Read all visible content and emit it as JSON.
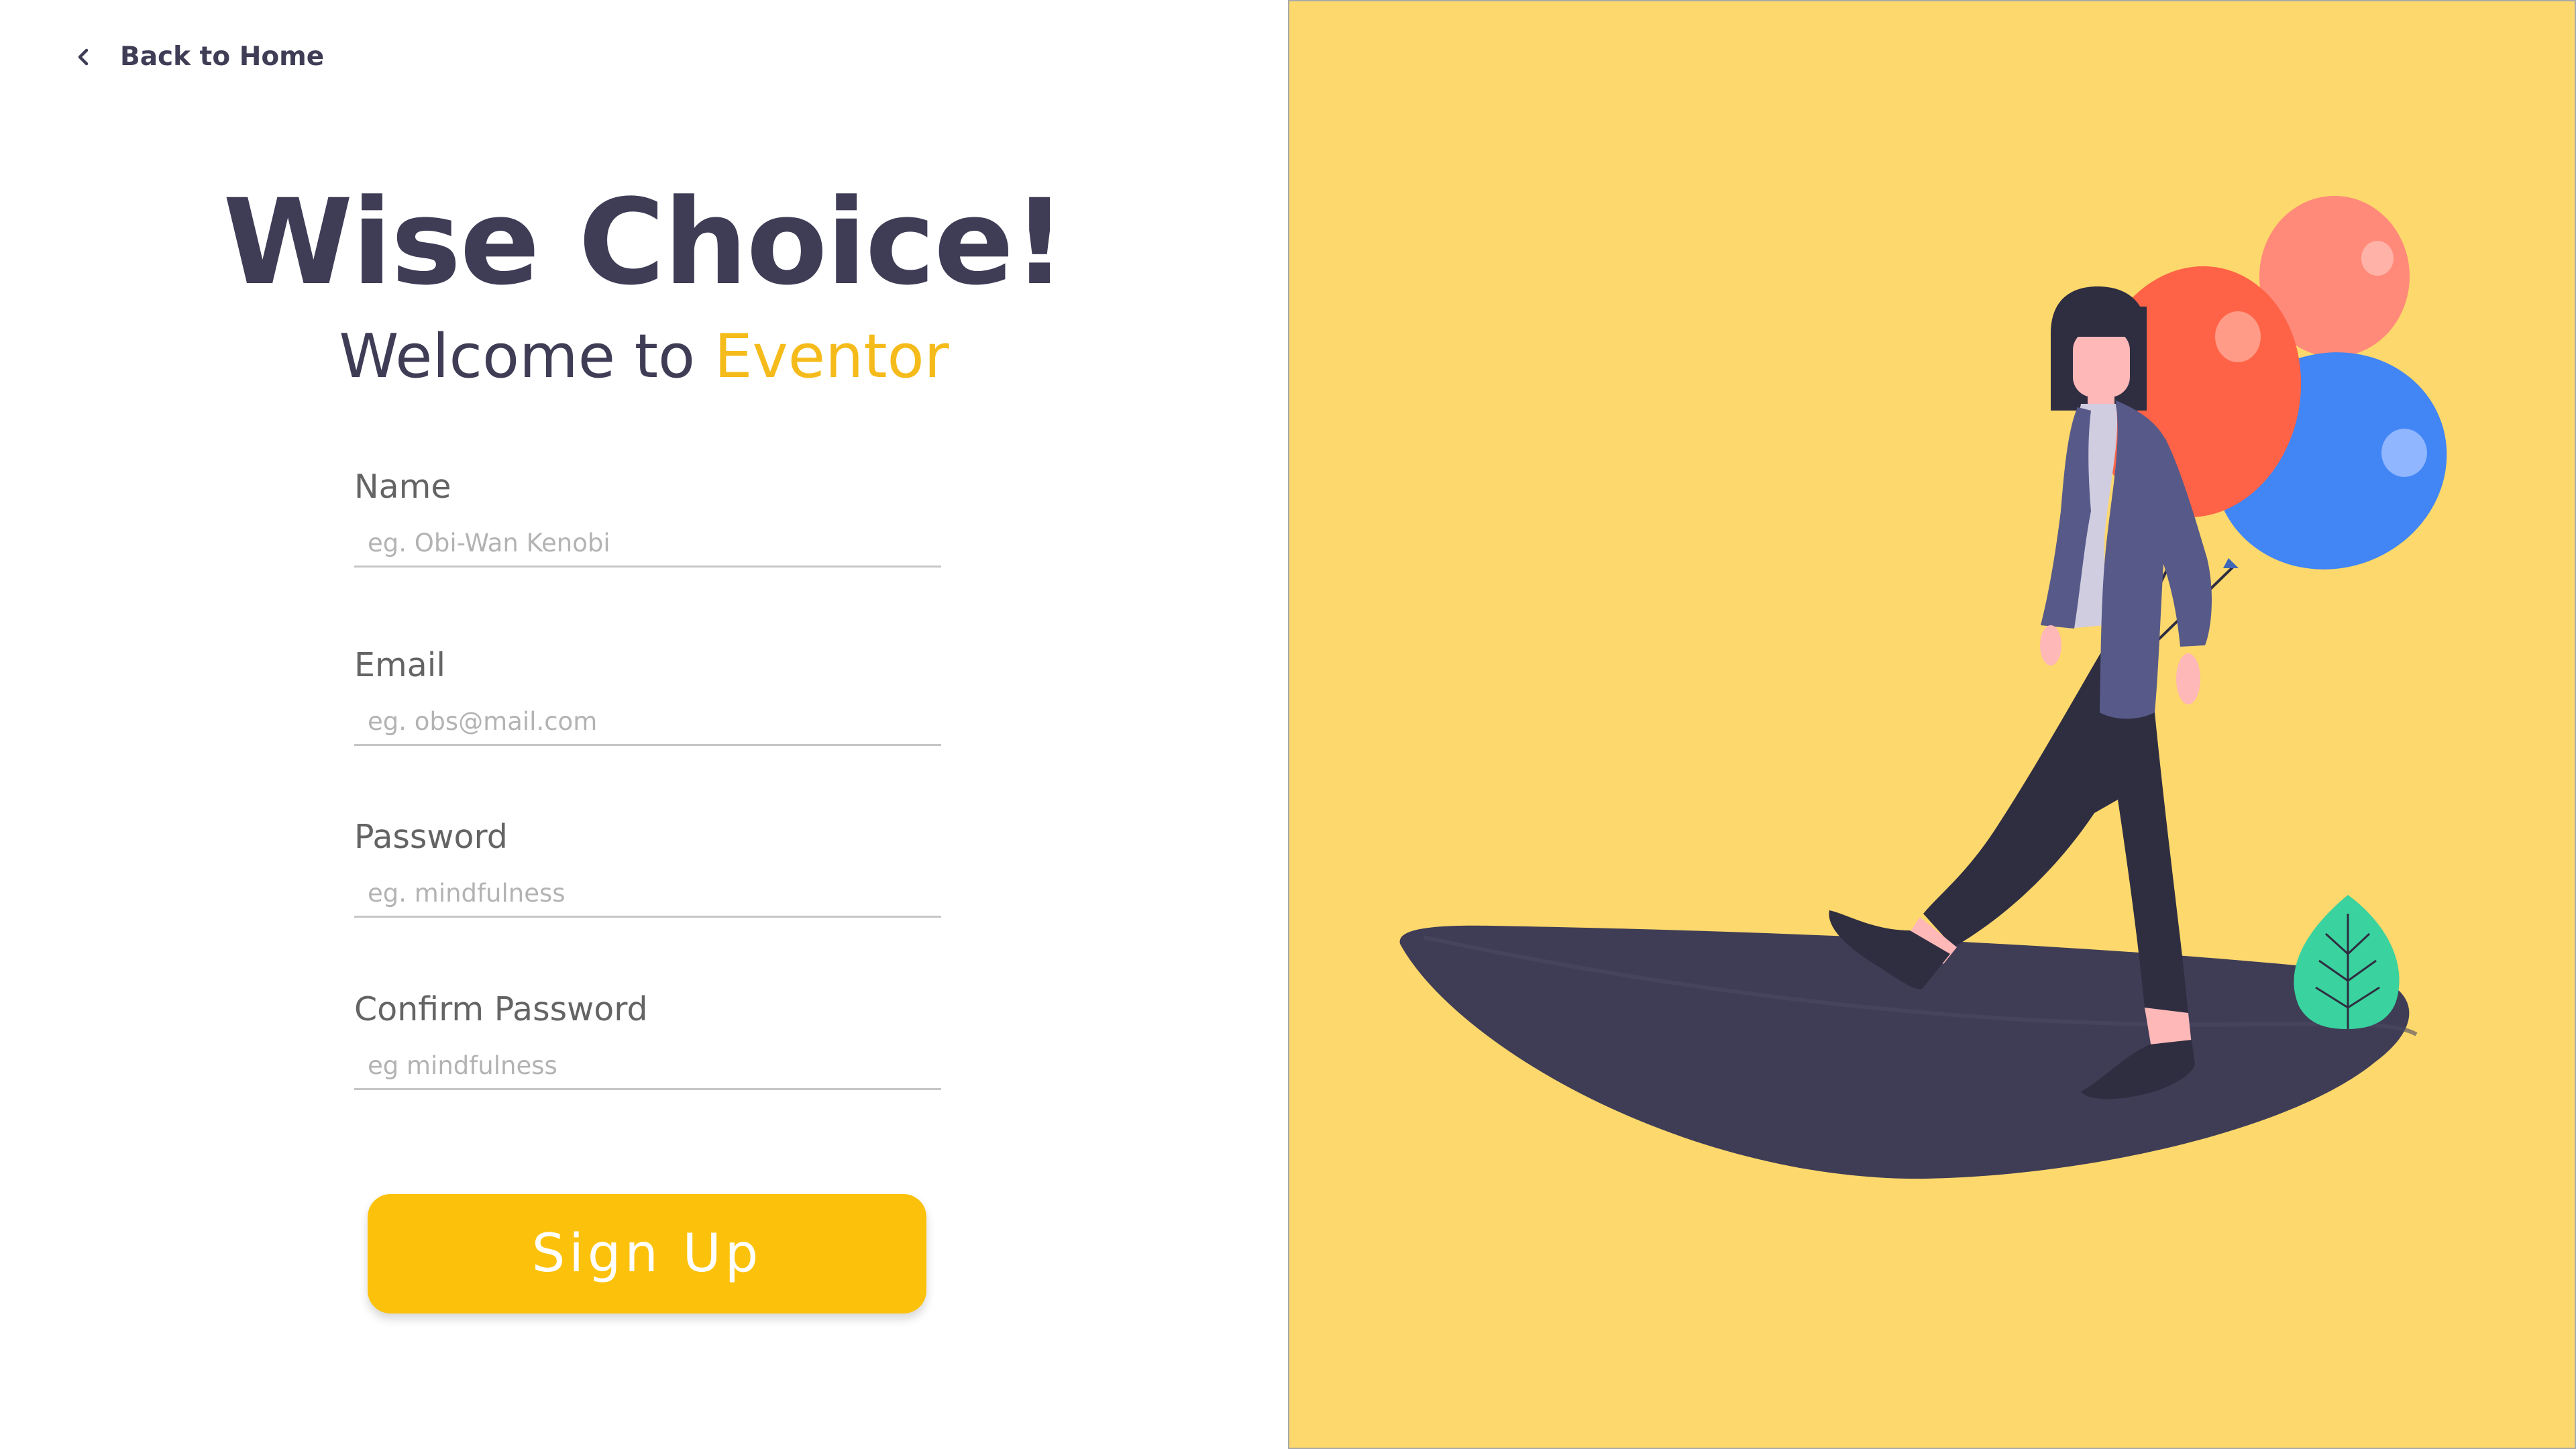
{
  "nav": {
    "back_label": "Back to Home"
  },
  "hero": {
    "title": "Wise Choice!",
    "welcome_prefix": "Welcome to ",
    "brand": "Eventor"
  },
  "form": {
    "name": {
      "label": "Name",
      "placeholder": "eg. Obi-Wan Kenobi",
      "value": ""
    },
    "email": {
      "label": "Email",
      "placeholder": "eg. obs@mail.com",
      "value": ""
    },
    "password": {
      "label": "Password",
      "placeholder": "eg. mindfulness",
      "value": ""
    },
    "confirm_password": {
      "label": "Confirm Password",
      "placeholder": "eg mindfulness",
      "value": ""
    },
    "submit_label": "Sign Up"
  },
  "colors": {
    "brand_accent": "#f5bb1a",
    "button": "#fcc20b",
    "heading": "#3f3d56",
    "illustration_bg": "#fdd86c"
  },
  "icons": {
    "back": "chevron-left-icon"
  }
}
